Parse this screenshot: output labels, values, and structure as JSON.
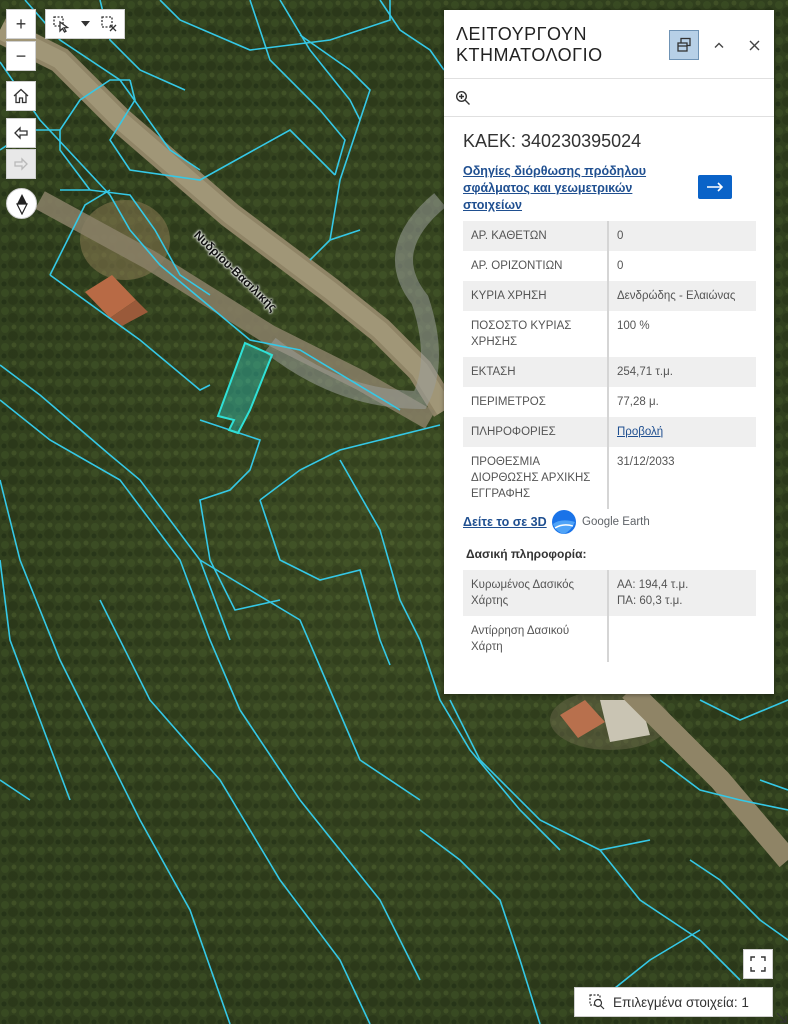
{
  "map": {
    "road_label": "Νυδρίου-Βασιλικής"
  },
  "toolbar": {
    "zoom_in": "+",
    "zoom_out": "−"
  },
  "panel": {
    "title": "ΛΕΙΤΟΥΡΓΟΥΝ ΚΤΗΜΑΤΟΛΟΓΙΟ",
    "kaek": "ΚΑΕΚ: 340230395024",
    "guide_link": "Οδηγίες διόρθωσης πρόδηλου σφάλματος και γεωμετρικών στοιχείων",
    "attributes": [
      {
        "key": "ΑΡ. ΚΑΘΕΤΩΝ",
        "value": "0"
      },
      {
        "key": "ΑΡ. ΟΡΙΖΟΝΤΙΩΝ",
        "value": "0"
      },
      {
        "key": "ΚΥΡΙΑ ΧΡΗΣΗ",
        "value": "Δενδρώδης - Ελαιώνας"
      },
      {
        "key": "ΠΟΣΟΣΤΟ ΚΥΡΙΑΣ ΧΡΗΣΗΣ",
        "value": "100 %"
      },
      {
        "key": "ΕΚΤΑΣΗ",
        "value": "254,71 τ.μ."
      },
      {
        "key": "ΠΕΡΙΜΕΤΡΟΣ",
        "value": "77,28 μ."
      },
      {
        "key": "ΠΛΗΡΟΦΟΡΙΕΣ",
        "value": "Προβολή"
      },
      {
        "key": "ΠΡΟΘΕΣΜΙΑ ΔΙΟΡΘΩΣΗΣ ΑΡΧΙΚΗΣ ΕΓΓΡΑΦΗΣ",
        "value": "31/12/2033"
      }
    ],
    "view_3d": "Δείτε το σε 3D",
    "google_earth": "Google Earth",
    "forest_title": "Δασική πληροφορία:",
    "forest": [
      {
        "key": "Κυρωμένος Δασικός Χάρτης",
        "value": "ΑΑ: 194,4 τ.μ.\nΠΑ: 60,3 τ.μ."
      },
      {
        "key": "Αντίρρηση Δασικού Χάρτη",
        "value": ""
      }
    ]
  },
  "selection": {
    "label": "Επιλεγμένα στοιχεία: 1"
  },
  "colors": {
    "parcel_lines": "#35c8e6",
    "selected_parcel": "#2fe0d6",
    "link": "#1f4f90",
    "button_blue": "#0a63c8"
  }
}
